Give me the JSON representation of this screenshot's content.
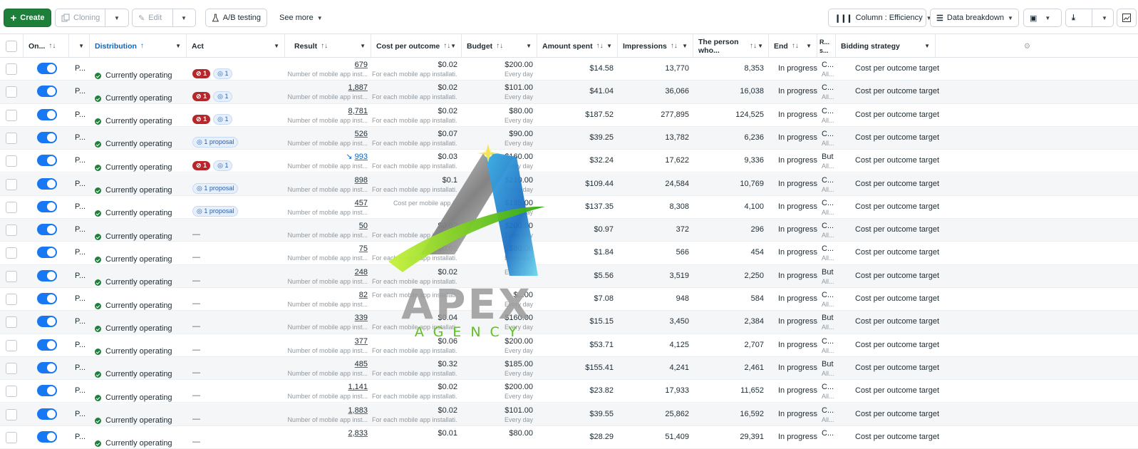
{
  "toolbar": {
    "create": "Create",
    "cloning": "Cloning",
    "edit": "Edit",
    "ab_testing": "A/B testing",
    "see_more": "See more",
    "column": "Column : Efficiency",
    "data_breakdown": "Data breakdown"
  },
  "columns": {
    "on": "On...",
    "distribution": "Distribution",
    "act": "Act",
    "result": "Result",
    "cpo": "Cost per outcome",
    "budget": "Budget",
    "amount_spent": "Amount spent",
    "impressions": "Impressions",
    "reach": "The person who...",
    "end": "End",
    "r": "R... s...",
    "bidding": "Bidding strategy"
  },
  "watermark": {
    "title": "APEX",
    "subtitle": "AGENCY"
  },
  "rows": [
    {
      "name": "P...",
      "dist": "Currently operating",
      "act": "red",
      "result": "679",
      "result_sub": "Number of mobile app inst...",
      "cpo": "$0.02",
      "cpo_sub": "For each mobile app installati...",
      "budget": "$200.00",
      "budget_sub": "Every day",
      "amount": "$14.58",
      "impressions": "13,770",
      "reach": "8,353",
      "end": "In progress",
      "r": "C...",
      "r_sub": "All...",
      "bid": "Cost per outcome target"
    },
    {
      "name": "P...",
      "dist": "Currently operating",
      "act": "red",
      "result": "1,887",
      "result_sub": "Number of mobile app inst...",
      "cpo": "$0.02",
      "cpo_sub": "For each mobile app installati...",
      "budget": "$101.00",
      "budget_sub": "Every day",
      "amount": "$41.04",
      "impressions": "36,066",
      "reach": "16,038",
      "end": "In progress",
      "r": "C...",
      "r_sub": "All...",
      "bid": "Cost per outcome target"
    },
    {
      "name": "P...",
      "dist": "Currently operating",
      "act": "red",
      "result": "8,781",
      "result_sub": "Number of mobile app inst...",
      "cpo": "$0.02",
      "cpo_sub": "For each mobile app installati...",
      "budget": "$80.00",
      "budget_sub": "Every day",
      "amount": "$187.52",
      "impressions": "277,895",
      "reach": "124,525",
      "end": "In progress",
      "r": "C...",
      "r_sub": "All...",
      "bid": "Cost per outcome target"
    },
    {
      "name": "P...",
      "dist": "Currently operating",
      "act": "proposal",
      "result": "526",
      "result_sub": "Number of mobile app inst...",
      "cpo": "$0.07",
      "cpo_sub": "For each mobile app installati...",
      "budget": "$90.00",
      "budget_sub": "Every day",
      "amount": "$39.25",
      "impressions": "13,782",
      "reach": "6,236",
      "end": "In progress",
      "r": "C...",
      "r_sub": "All...",
      "bid": "Cost per outcome target"
    },
    {
      "name": "P...",
      "dist": "Currently operating",
      "act": "red",
      "result": "993",
      "result_link": true,
      "result_sub": "Number of mobile app inst...",
      "cpo": "$0.03",
      "cpo_sub": "For each mobile app installati...",
      "budget": "$160.00",
      "budget_sub": "Every day",
      "amount": "$32.24",
      "impressions": "17,622",
      "reach": "9,336",
      "end": "In progress",
      "r": "But",
      "r_sub": "All...",
      "bid": "Cost per outcome target"
    },
    {
      "name": "P...",
      "dist": "Currently operating",
      "act": "proposal",
      "result": "898",
      "result_sub": "Number of mobile app inst...",
      "cpo": "$0.1",
      "cpo_sub": "For each mobile app installati...",
      "budget": "$210.00",
      "budget_sub": "Every day",
      "amount": "$109.44",
      "impressions": "24,584",
      "reach": "10,769",
      "end": "In progress",
      "r": "C...",
      "r_sub": "All...",
      "bid": "Cost per outcome target"
    },
    {
      "name": "P...",
      "dist": "Currently operating",
      "act": "proposal",
      "result": "457",
      "result_sub": "Number of mobile app inst...",
      "cpo": "",
      "cpo_sub": "Cost per mobile app in",
      "budget": "$185.00",
      "budget_sub": "Every day",
      "amount": "$137.35",
      "impressions": "8,308",
      "reach": "4,100",
      "end": "In progress",
      "r": "C...",
      "r_sub": "All...",
      "bid": "Cost per outcome target"
    },
    {
      "name": "P...",
      "dist": "Currently operating",
      "act": "dash",
      "result": "50",
      "result_sub": "Number of mobile app inst...",
      "cpo": "$0.02",
      "cpo_sub": "For each mobile app installati...",
      "budget": "$200.00",
      "budget_sub": "Every day",
      "amount": "$0.97",
      "impressions": "372",
      "reach": "296",
      "end": "In progress",
      "r": "C...",
      "r_sub": "All...",
      "bid": "Cost per outcome target"
    },
    {
      "name": "P...",
      "dist": "Currently operating",
      "act": "dash",
      "result": "75",
      "result_sub": "Number of mobile app inst...",
      "cpo": "$0.02",
      "cpo_sub": "For each mobile app installati...",
      "budget": "$80.00",
      "budget_sub": "Every day",
      "amount": "$1.84",
      "impressions": "566",
      "reach": "454",
      "end": "In progress",
      "r": "C...",
      "r_sub": "All...",
      "bid": "Cost per outcome target"
    },
    {
      "name": "P...",
      "dist": "Currently operating",
      "act": "dash",
      "result": "248",
      "result_sub": "Number of mobile app inst...",
      "cpo": "$0.02",
      "cpo_sub": "For each mobile app installati...",
      "budget": "",
      "budget_sub": "Every day",
      "amount": "$5.56",
      "impressions": "3,519",
      "reach": "2,250",
      "end": "In progress",
      "r": "But",
      "r_sub": "All...",
      "bid": "Cost per outcome target"
    },
    {
      "name": "P...",
      "dist": "Currently operating",
      "act": "dash",
      "result": "82",
      "result_sub": "Number of mobile app inst...",
      "cpo": "",
      "cpo_sub": "For each mobile app installati...",
      "budget": "$...00",
      "budget_sub": "Every day",
      "amount": "$7.08",
      "impressions": "948",
      "reach": "584",
      "end": "In progress",
      "r": "C...",
      "r_sub": "All...",
      "bid": "Cost per outcome target"
    },
    {
      "name": "P...",
      "dist": "Currently operating",
      "act": "dash",
      "result": "339",
      "result_sub": "Number of mobile app inst...",
      "cpo": "$0.04",
      "cpo_sub": "For each mobile app installati...",
      "budget": "$160.00",
      "budget_sub": "Every day",
      "amount": "$15.15",
      "impressions": "3,450",
      "reach": "2,384",
      "end": "In progress",
      "r": "But",
      "r_sub": "All...",
      "bid": "Cost per outcome target"
    },
    {
      "name": "P...",
      "dist": "Currently operating",
      "act": "dash",
      "result": "377",
      "result_sub": "Number of mobile app inst...",
      "cpo": "$0.06",
      "cpo_sub": "For each mobile app installati...",
      "budget": "$200.00",
      "budget_sub": "Every day",
      "amount": "$53.71",
      "impressions": "4,125",
      "reach": "2,707",
      "end": "In progress",
      "r": "C...",
      "r_sub": "All...",
      "bid": "Cost per outcome target"
    },
    {
      "name": "P...",
      "dist": "Currently operating",
      "act": "dash",
      "result": "485",
      "result_sub": "Number of mobile app inst...",
      "cpo": "$0.32",
      "cpo_sub": "For each mobile app installati...",
      "budget": "$185.00",
      "budget_sub": "Every day",
      "amount": "$155.41",
      "impressions": "4,241",
      "reach": "2,461",
      "end": "In progress",
      "r": "But",
      "r_sub": "All...",
      "bid": "Cost per outcome target"
    },
    {
      "name": "P...",
      "dist": "Currently operating",
      "act": "dash",
      "result": "1,141",
      "result_sub": "Number of mobile app inst...",
      "cpo": "$0.02",
      "cpo_sub": "For each mobile app installati...",
      "budget": "$200.00",
      "budget_sub": "Every day",
      "amount": "$23.82",
      "impressions": "17,933",
      "reach": "11,652",
      "end": "In progress",
      "r": "C...",
      "r_sub": "All...",
      "bid": "Cost per outcome target"
    },
    {
      "name": "P...",
      "dist": "Currently operating",
      "act": "dash",
      "result": "1,883",
      "result_sub": "Number of mobile app inst...",
      "cpo": "$0.02",
      "cpo_sub": "For each mobile app installati...",
      "budget": "$101.00",
      "budget_sub": "Every day",
      "amount": "$39.55",
      "impressions": "25,862",
      "reach": "16,592",
      "end": "In progress",
      "r": "C...",
      "r_sub": "All...",
      "bid": "Cost per outcome target"
    },
    {
      "name": "P...",
      "dist": "Currently operating",
      "act": "dash",
      "result": "2,833",
      "result_sub": "",
      "cpo": "$0.01",
      "cpo_sub": "",
      "budget": "$80.00",
      "budget_sub": "",
      "amount": "$28.29",
      "impressions": "51,409",
      "reach": "29,391",
      "end": "In progress",
      "r": "C...",
      "r_sub": "",
      "bid": "Cost per outcome target"
    }
  ],
  "badges": {
    "red_count": "1",
    "blue_count": "1",
    "proposal": "1 proposal",
    "dash": "—"
  },
  "colors": {
    "accent": "#1877f2",
    "create": "#1e7f3a",
    "alert": "#b7262b"
  }
}
